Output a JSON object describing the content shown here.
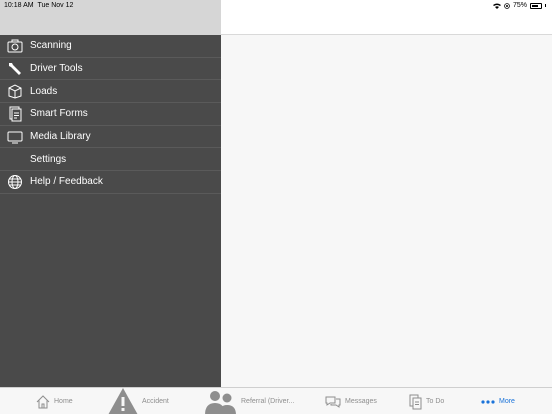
{
  "status": {
    "time": "10:18 AM",
    "date": "Tue Nov 12",
    "battery": "75%",
    "battery_level": 0.75
  },
  "menu": {
    "items": [
      {
        "label": "Scanning",
        "icon": "camera-icon"
      },
      {
        "label": "Driver Tools",
        "icon": "wrench-icon"
      },
      {
        "label": "Loads",
        "icon": "box-icon"
      },
      {
        "label": "Smart Forms",
        "icon": "forms-icon"
      },
      {
        "label": "Media Library",
        "icon": "tv-icon"
      },
      {
        "label": "Settings",
        "icon": ""
      },
      {
        "label": "Help / Feedback",
        "icon": "globe-icon"
      }
    ]
  },
  "tabs": [
    {
      "label": "Home",
      "icon": "home-icon"
    },
    {
      "label": "Accident",
      "icon": "warning-icon"
    },
    {
      "label": "Referral (Driver...",
      "icon": "people-icon"
    },
    {
      "label": "Messages",
      "icon": "chat-icon"
    },
    {
      "label": "To Do",
      "icon": "todo-icon"
    },
    {
      "label": "More",
      "icon": "more-dots-icon",
      "active": true
    }
  ],
  "colors": {
    "menu_bg": "#4a4a4a",
    "header_bg": "#d6d6d6",
    "accent": "#1a73d9"
  }
}
